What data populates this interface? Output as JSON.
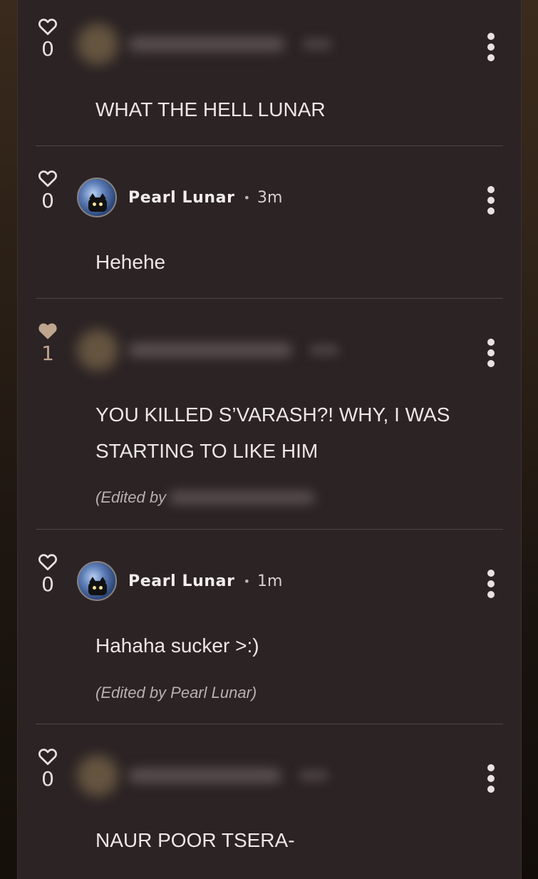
{
  "comments": [
    {
      "likes": "0",
      "liked": false,
      "author_visible": false,
      "author": "",
      "time": "",
      "text": "WHAT THE HELL LUNAR",
      "edited": ""
    },
    {
      "likes": "0",
      "liked": false,
      "author_visible": true,
      "author": "Pearl Lunar",
      "time": "3m",
      "text": "Hehehe",
      "edited": ""
    },
    {
      "likes": "1",
      "liked": true,
      "author_visible": false,
      "author": "",
      "time": "",
      "text": "YOU KILLED S’VARASH?! WHY, I WAS STARTING TO LIKE HIM",
      "edited": "(Edited by"
    },
    {
      "likes": "0",
      "liked": false,
      "author_visible": true,
      "author": "Pearl Lunar",
      "time": "1m",
      "text": "Hahaha sucker >:)",
      "edited": "(Edited by Pearl Lunar)"
    },
    {
      "likes": "0",
      "liked": false,
      "author_visible": false,
      "author": "",
      "time": "",
      "text": "NAUR POOR TSERA-",
      "edited": ""
    }
  ],
  "separator": "•",
  "icons": {
    "like": "heart-outline-icon",
    "liked": "heart-filled-icon",
    "menu": "more-vertical-icon"
  },
  "colors": {
    "panel": "#2b2324",
    "text": "#ece7e4",
    "liked": "#bfa58e",
    "divider": "#4e4546"
  }
}
